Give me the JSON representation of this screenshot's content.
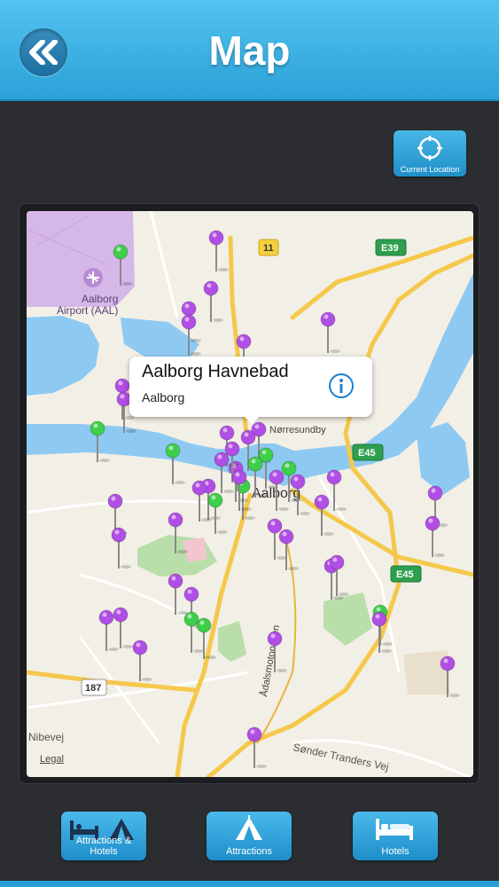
{
  "header": {
    "title": "Map"
  },
  "toolbar": {
    "current_location_label": "Current Location"
  },
  "map": {
    "airport_name_line1": "Aalborg",
    "airport_name_line2": "Airport (AAL)",
    "city_label": "Aalborg",
    "district_label": "Nørresundby",
    "road_labels": {
      "adalsmotorvejen": "Ådalsmotorvejen",
      "nibevej": "Nibevej",
      "sonder_tranders": "Sønder Tranders Vej"
    },
    "route_badges": {
      "r11": "11",
      "e39": "E39",
      "e45_a": "E45",
      "e45_b": "E45",
      "r187": "187"
    },
    "legal_label": "Legal",
    "callout": {
      "title": "Aalborg Havnebad",
      "subtitle": "Aalborg"
    },
    "pin_colors": {
      "attraction": "#b14ee6",
      "hotel": "#3ecf4a"
    }
  },
  "bottom_bar": {
    "attractions_hotels_label": "Attractions & Hotels",
    "attractions_label": "Attractions",
    "hotels_label": "Hotels"
  }
}
